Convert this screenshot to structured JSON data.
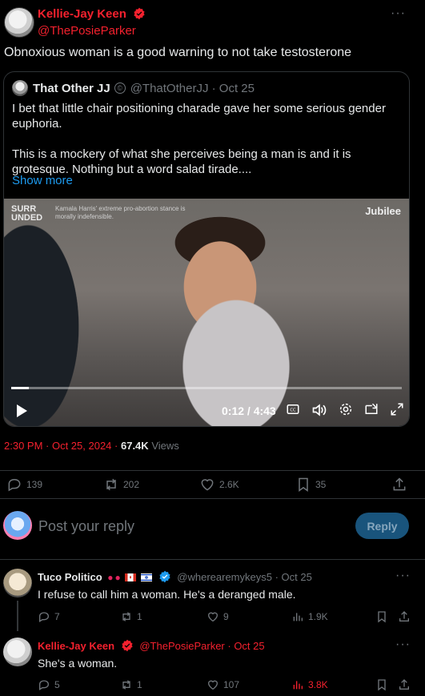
{
  "main_tweet": {
    "name": "Kellie-Jay Keen",
    "handle": "@ThePosieParker",
    "text": "Obnoxious woman is a good warning to not take testosterone",
    "time": "2:30 PM · Oct 25, 2024 ·",
    "views_count": "67.4K",
    "views_label": "Views",
    "stats": {
      "replies": "139",
      "reposts": "202",
      "likes": "2.6K",
      "bookmarks": "35"
    }
  },
  "quote": {
    "name": "That Other JJ",
    "meta": "@ThatOtherJJ · Oct 25",
    "text_1": "I bet that little chair positioning charade gave her some serious gender euphoria.",
    "text_2": "This is a mockery of what she perceives being a man is and it is grotesque. Nothing but a word salad tirade....",
    "show_more": "Show more",
    "video": {
      "brand_left_1": "SURR",
      "brand_left_2": "UNDED",
      "brand_left_sub": "Kamala Harris' extreme pro-abortion stance is morally indefensible.",
      "brand_right": "Jubilee",
      "time": "0:12 / 4:43",
      "progress": 0.045
    }
  },
  "reply_box": {
    "placeholder": "Post your reply",
    "button": "Reply"
  },
  "replies": [
    {
      "name": "Tuco Politico",
      "meta": "@wherearemykeys5 · Oct 25",
      "text": "I refuse to call him a woman. He's a deranged male.",
      "stats": {
        "replies": "7",
        "reposts": "1",
        "likes": "9",
        "views": "1.9K"
      }
    },
    {
      "name": "Kellie-Jay Keen",
      "meta": "@ThePosieParker · Oct 25",
      "text": "She's a woman.",
      "stats": {
        "replies": "5",
        "reposts": "1",
        "likes": "107",
        "views": "3.8K"
      }
    }
  ],
  "colors": {
    "accent": "#1d9bf0",
    "red": "#f4212e",
    "muted": "#71767b",
    "border": "#2f3336"
  }
}
